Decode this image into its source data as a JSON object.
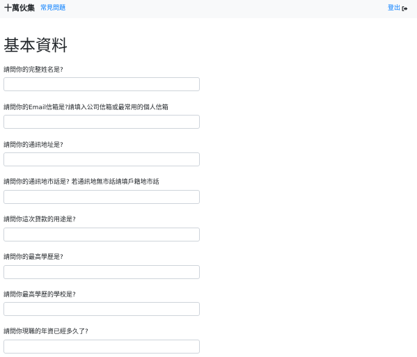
{
  "navbar": {
    "brand": "十萬伙集",
    "faq_link": "常見問題",
    "logout_label": "登出",
    "logout_icon": "sign-out-icon"
  },
  "page": {
    "title": "基本資料"
  },
  "form": {
    "fields": [
      {
        "label": "請問你的完整姓名是?",
        "value": ""
      },
      {
        "label": "請問你的Email信箱是?請填入公司信箱或最常用的個人信箱",
        "value": ""
      },
      {
        "label": "請問你的通訊地址是?",
        "value": ""
      },
      {
        "label": "請問你的通訊地市話是? 若通訊地無市話請填戶籍地市話",
        "value": ""
      },
      {
        "label": "請問你這次貸款的用途是?",
        "value": ""
      },
      {
        "label": "請問你的最高學歷是?",
        "value": ""
      },
      {
        "label": "請問你最高學歷的學校是?",
        "value": ""
      },
      {
        "label": "請問你現職的年資已經多久了?",
        "value": ""
      }
    ]
  },
  "colors": {
    "navbar_bg": "#f8f9fa",
    "link": "#007bff",
    "input_border": "#ced4da"
  }
}
